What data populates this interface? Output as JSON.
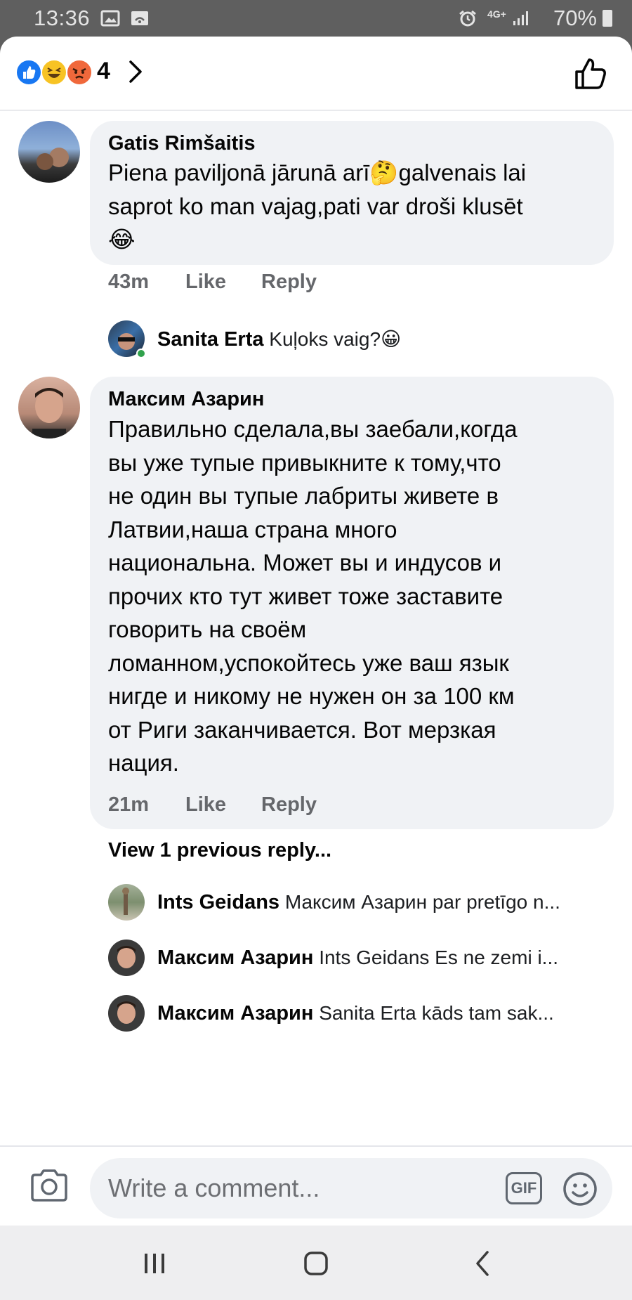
{
  "status_bar": {
    "time": "13:36",
    "network": "4G+",
    "battery": "70%",
    "icons": [
      "image-icon",
      "wifi-calling-icon",
      "alarm-icon",
      "signal-icon",
      "battery-icon"
    ]
  },
  "reactions": {
    "types": [
      "like",
      "haha",
      "angry"
    ],
    "count": "4"
  },
  "comments": [
    {
      "author": "Gatis Rimšaitis",
      "text": "Piena paviljonā jārunā arī🤔galvenais lai\nsaprot ko man vajag,pati var droši klusēt\n😂",
      "time": "43m",
      "like_label": "Like",
      "reply_label": "Reply",
      "replies": [
        {
          "author": "Sanita Erta",
          "snippet": "Kuļoks vaig?😀"
        }
      ]
    },
    {
      "author": "Максим Азарин",
      "text": "Правильно сделала,вы заебали,когда\nвы уже тупые привыкните к тому,что\nне один вы тупые лабриты живете в\nЛатвии,наша страна много\nнациональна. Может вы и индусов и\nпрочих кто тут живет тоже заставите\nговорить на своём\nломанном,успокойтесь уже ваш язык\nнигде и никому не нужен он за 100 км\nот Риги заканчивается.  Вот мерзкая\nнация.",
      "time": "21m",
      "like_label": "Like",
      "reply_label": "Reply",
      "view_previous": "View 1 previous reply...",
      "replies": [
        {
          "author": "Ints Geidans",
          "snippet": "Максим Азарин par pretīgo n..."
        },
        {
          "author": "Максим Азарин",
          "snippet": "Ints Geidans Es ne zemi i..."
        },
        {
          "author": "Максим Азарин",
          "snippet": "Sanita Erta kāds tam sak..."
        }
      ]
    }
  ],
  "composer": {
    "placeholder": "Write a comment...",
    "gif_label": "GIF"
  },
  "colors": {
    "bubble": "#f0f2f5",
    "meta_text": "#65676b",
    "like_blue": "#1877f2",
    "haha_yellow": "#f7c324",
    "angry_orange": "#f0683b",
    "online_green": "#31a24c"
  }
}
